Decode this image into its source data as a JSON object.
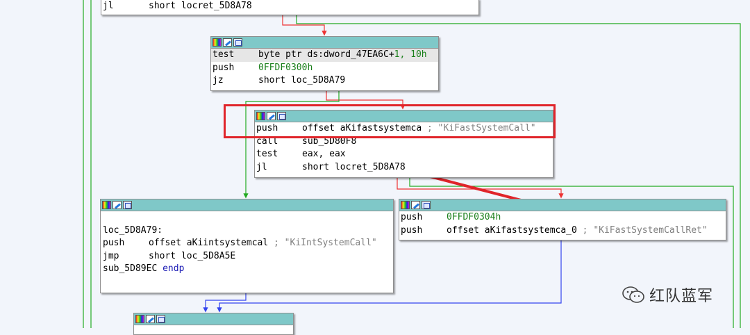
{
  "nodes": [
    {
      "lines": [
        {
          "mn": "jl",
          "op": "short locret_5D8A78"
        }
      ]
    },
    {
      "lines": [
        {
          "mn": "test",
          "op": "byte ptr ds:dword_47EA6C+",
          "num": "1, 10h"
        },
        {
          "mn": "push",
          "num": "0FFDF0300h"
        },
        {
          "mn": "jz",
          "op": "short loc_5D8A79"
        }
      ]
    },
    {
      "lines": [
        {
          "mn": "push",
          "op": "offset aKifastsystemca ",
          "cmt": "; \"KiFastSystemCall\""
        },
        {
          "mn": "call",
          "op": "sub_5D80F8"
        },
        {
          "mn": "test",
          "op": "eax, eax"
        },
        {
          "mn": "jl",
          "op": "short locret_5D8A78"
        }
      ]
    },
    {
      "lines": [
        {
          "label": ""
        },
        {
          "label": "loc_5D8A79:"
        },
        {
          "mn": "push",
          "op": "offset aKiintsystemcal ",
          "cmt": "; \"KiIntSystemCall\""
        },
        {
          "mn": "jmp",
          "op": "short loc_5D8A5E"
        },
        {
          "label": "sub_5D89EC ",
          "kw": "endp"
        }
      ]
    },
    {
      "lines": [
        {
          "mn": "push",
          "num": "0FFDF0304h"
        },
        {
          "mn": "push",
          "op": "offset aKifastsystemca_0 ",
          "cmt": "; \"KiFastSystemCallRet\""
        }
      ]
    },
    {
      "lines": []
    }
  ],
  "watermark": {
    "text": "红队蓝军",
    "icon": "wechat-icon"
  },
  "colors": {
    "true_edge": "#22aa22",
    "false_edge": "#ee3333",
    "jump_edge": "#3344ee",
    "node_header": "#7fc8c8",
    "annotation": "#e0242a"
  }
}
